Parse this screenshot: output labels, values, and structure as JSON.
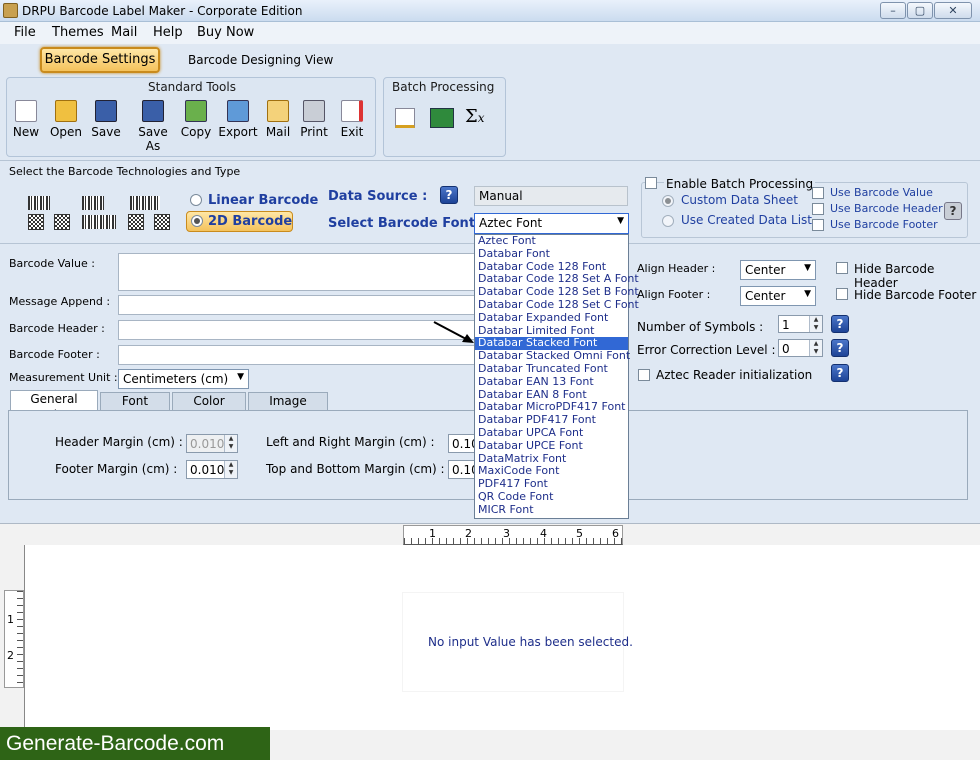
{
  "window": {
    "title": "DRPU Barcode Label Maker - Corporate Edition",
    "btn_min": "–",
    "btn_max": "▢",
    "btn_close": "✕"
  },
  "menu": [
    "File",
    "Themes",
    "Mail",
    "Help",
    "Buy Now"
  ],
  "tabs": {
    "barcode_settings": "Barcode Settings",
    "designing_view": "Barcode Designing View"
  },
  "standard_tools": {
    "title": "Standard Tools",
    "items": [
      "New",
      "Open",
      "Save",
      "Save As",
      "Copy",
      "Export",
      "Mail",
      "Print",
      "Exit"
    ]
  },
  "batch_processing": {
    "title": "Batch Processing"
  },
  "tech": {
    "title": "Select the Barcode Technologies and Type",
    "linear": "Linear Barcode",
    "twod": "2D Barcode"
  },
  "data_source": {
    "label": "Data Source :",
    "value": "Manual"
  },
  "barcode_font": {
    "label": "Select Barcode Font :",
    "value": "Aztec Font"
  },
  "batch": {
    "enable": "Enable Batch Processing",
    "custom_sheet": "Custom Data Sheet",
    "created_list": "Use Created Data List",
    "use_value": "Use Barcode Value",
    "use_header": "Use Barcode Header",
    "use_footer": "Use Barcode Footer"
  },
  "fonts": [
    "Aztec Font",
    "Databar Font",
    "Databar Code 128 Font",
    "Databar Code 128 Set A Font",
    "Databar Code 128 Set B Font",
    "Databar Code 128 Set C Font",
    "Databar Expanded Font",
    "Databar Limited Font",
    "Databar Stacked Font",
    "Databar Stacked Omni Font",
    "Databar Truncated Font",
    "Databar EAN 13 Font",
    "Databar EAN 8 Font",
    "Databar MicroPDF417 Font",
    "Databar PDF417 Font",
    "Databar UPCA Font",
    "Databar UPCE Font",
    "DataMatrix Font",
    "MaxiCode Font",
    "PDF417 Font",
    "QR Code Font",
    "MICR Font"
  ],
  "form": {
    "barcode_value": "Barcode Value :",
    "message_append": "Message Append :",
    "barcode_header": "Barcode Header :",
    "barcode_footer": "Barcode Footer :",
    "measurement_unit": "Measurement Unit :",
    "measurement_value": "Centimeters (cm)"
  },
  "right_form": {
    "align_header": "Align Header :",
    "align_header_value": "Center",
    "align_footer": "Align Footer :",
    "align_footer_value": "Center",
    "hide_header": "Hide Barcode Header",
    "hide_footer": "Hide Barcode Footer",
    "num_symbols": "Number of Symbols :",
    "num_symbols_value": "1",
    "error_level": "Error Correction Level :",
    "error_level_value": "0",
    "aztec_reader": "Aztec Reader initialization"
  },
  "settings_tabs": [
    "General Settings",
    "Font Settings",
    "Color Settings",
    "Image Settings"
  ],
  "general": {
    "header_margin": "Header Margin (cm) :",
    "header_margin_value": "0.010",
    "footer_margin": "Footer Margin (cm) :",
    "footer_margin_value": "0.010",
    "lr_margin": "Left  and Right Margin (cm) :",
    "lr_value": "0.100",
    "tb_margin": "Top and Bottom Margin (cm) :",
    "tb_value": "0.100"
  },
  "ruler": {
    "h": [
      "1",
      "2",
      "3",
      "4",
      "5",
      "6"
    ],
    "v": [
      "1",
      "2"
    ]
  },
  "canvas": {
    "message": "No input Value has been selected."
  },
  "watermark": "Generate-Barcode.com"
}
